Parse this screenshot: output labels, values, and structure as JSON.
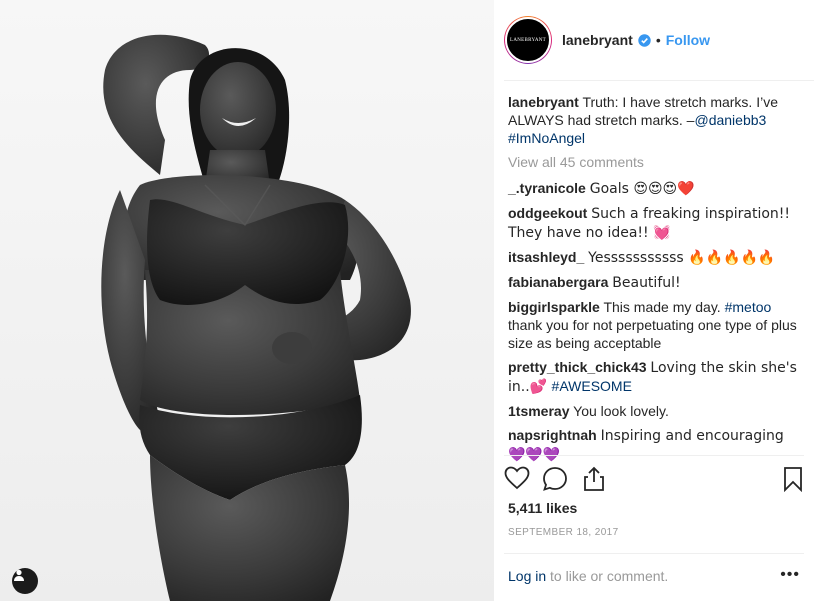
{
  "post": {
    "username": "lanebryant",
    "avatar_text": "LANEBRYANT",
    "follow_label": "Follow",
    "caption_text": "Truth: I have stretch marks. I’ve ALWAYS had stretch marks. –",
    "caption_mention": "@daniebb3",
    "caption_hashtag": "#ImNoAngel",
    "view_all": "View all 45 comments",
    "likes": "5,411 likes",
    "date": "SEPTEMBER 18, 2017",
    "login_link": "Log in",
    "login_rest": " to like or comment.",
    "more": "•••"
  },
  "comments": [
    {
      "user": "_.tyranicole",
      "text": "Goals 😍😍😍❤️"
    },
    {
      "user": "oddgeekout",
      "text": "Such a freaking inspiration!! They have no idea!! 💓"
    },
    {
      "user": "itsashleyd_",
      "text": "Yesssssssssss 🔥🔥🔥🔥🔥"
    },
    {
      "user": "fabianabergara",
      "text": "Beautiful!"
    },
    {
      "user": "biggirlsparkle",
      "text": "This made my day. ",
      "tag": "#metoo",
      "text2": " thank you for not perpetuating one type of plus size as being acceptable"
    },
    {
      "user": "pretty_thick_chick43",
      "text": "Loving the skin she's in..💕 ",
      "tag": "#AWESOME"
    },
    {
      "user": "1tsmeray",
      "text": "You look lovely."
    },
    {
      "user": "napsrightnah",
      "text": "Inspiring and encouraging 💜💜💜"
    }
  ],
  "icons": {
    "verified": "verified-badge-icon",
    "like": "heart-icon",
    "comment": "comment-bubble-icon",
    "share": "share-icon",
    "save": "bookmark-icon",
    "tag": "user-tag-icon"
  },
  "colors": {
    "link": "#3897f0",
    "tag": "#003569",
    "muted": "#999999",
    "text": "#262626"
  }
}
